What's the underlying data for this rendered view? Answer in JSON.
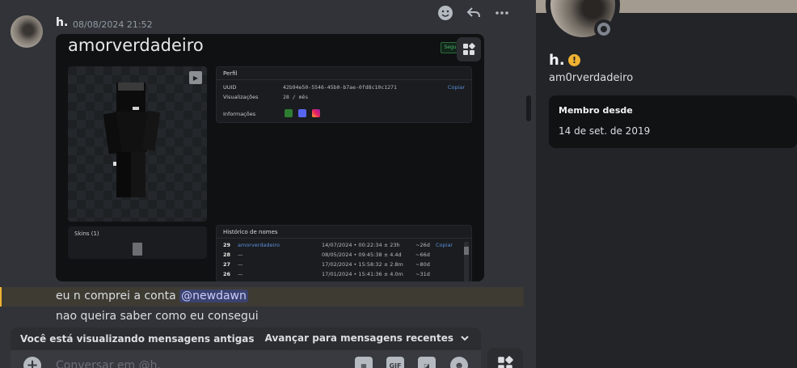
{
  "message": {
    "username": "h.",
    "timestamp": "08/08/2024 21:52",
    "lines": [
      "eu n comprei a conta ",
      "nao queira saber como eu consegui"
    ],
    "mention": "@newdawn"
  },
  "embed": {
    "site_title": "amorverdadeiro",
    "site_button": "Segu",
    "perfil_title": "Perfil",
    "uuid_label": "UUID",
    "uuid_value": "42b94e50-5546-45b0-b7ae-0fd8c10c1271",
    "copy_label": "Copiar",
    "views_label": "Visualizações",
    "views_value": "28 / mês",
    "info_label": "Informações",
    "skins_label": "Skins (1)",
    "history_title": "Histórico de nomes",
    "history": [
      {
        "num": "29",
        "name": "amorverdadeiro",
        "date": "14/07/2024 • 00:22:34 ± 23h",
        "ago": "~26d",
        "copy": "Copiar"
      },
      {
        "num": "28",
        "name": "—",
        "date": "08/05/2024 • 09:45:38 ± 4.4d",
        "ago": "~66d",
        "copy": ""
      },
      {
        "num": "27",
        "name": "—",
        "date": "17/02/2024 • 15:58:32 ± 2.8m",
        "ago": "~80d",
        "copy": ""
      },
      {
        "num": "26",
        "name": "—",
        "date": "17/01/2024 • 15:41:36 ± 4.0m",
        "ago": "~31d",
        "copy": ""
      }
    ]
  },
  "old_messages": {
    "notice": "Você está visualizando mensagens antigas",
    "jump": "Avançar para mensagens recentes"
  },
  "composer": {
    "placeholder": "Conversar em @h.",
    "gif_label": "GIF"
  },
  "profile": {
    "display_name": "h.",
    "username": "am0rverdadeiro",
    "member_since_label": "Membro desde",
    "member_since_date": "14 de set. de 2019"
  },
  "colors": {
    "background": "#313338",
    "sidebar": "#232428",
    "mention_bg": "#3c4270",
    "highlight": "#3e3b33",
    "warning": "#f0b232"
  }
}
